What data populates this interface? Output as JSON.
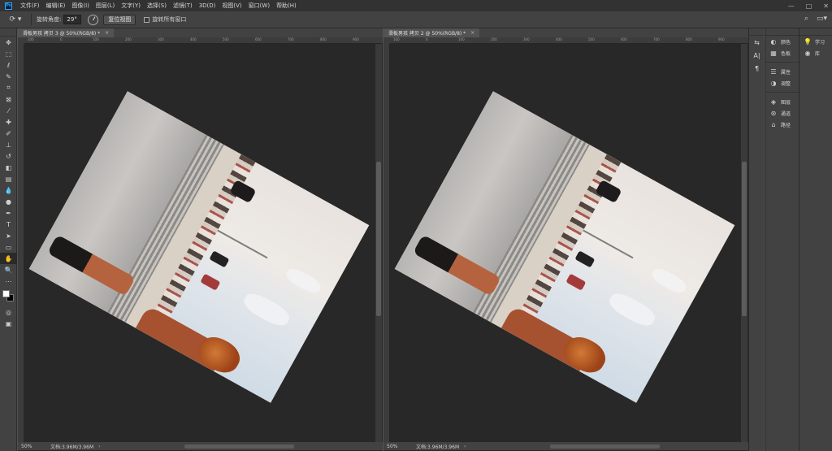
{
  "app": {
    "logo": "Ps"
  },
  "menu": [
    "文件(F)",
    "编辑(E)",
    "图像(I)",
    "图层(L)",
    "文字(Y)",
    "选择(S)",
    "滤镜(T)",
    "3D(D)",
    "视图(V)",
    "窗口(W)",
    "帮助(H)"
  ],
  "window_controls": {
    "minimize": "—",
    "maximize": "□",
    "close": "✕"
  },
  "options": {
    "tool_icon": "rotate-view-icon",
    "rotation_label": "旋转角度:",
    "rotation_value": "29°",
    "reset_view_label": "复位视图",
    "rotate_all_label": "旋转所有窗口",
    "search_icon": "search-icon",
    "workspace_icon": "workspace-icon"
  },
  "tools": [
    {
      "name": "move-tool",
      "glyph": "✥"
    },
    {
      "name": "marquee-tool",
      "glyph": "⬚"
    },
    {
      "name": "lasso-tool",
      "glyph": "ℓ"
    },
    {
      "name": "quick-select-tool",
      "glyph": "✎"
    },
    {
      "name": "crop-tool",
      "glyph": "⌗"
    },
    {
      "name": "frame-tool",
      "glyph": "⊠"
    },
    {
      "name": "eyedropper-tool",
      "glyph": "⁄"
    },
    {
      "name": "healing-brush-tool",
      "glyph": "✚"
    },
    {
      "name": "brush-tool",
      "glyph": "✐"
    },
    {
      "name": "clone-stamp-tool",
      "glyph": "⊥"
    },
    {
      "name": "history-brush-tool",
      "glyph": "↺"
    },
    {
      "name": "eraser-tool",
      "glyph": "◧"
    },
    {
      "name": "gradient-tool",
      "glyph": "▤"
    },
    {
      "name": "blur-tool",
      "glyph": "💧"
    },
    {
      "name": "dodge-tool",
      "glyph": "●"
    },
    {
      "name": "pen-tool",
      "glyph": "✒"
    },
    {
      "name": "type-tool",
      "glyph": "T"
    },
    {
      "name": "path-selection-tool",
      "glyph": "➤"
    },
    {
      "name": "rectangle-tool",
      "glyph": "▭"
    },
    {
      "name": "hand-tool",
      "glyph": "✋"
    },
    {
      "name": "zoom-tool",
      "glyph": "🔍"
    },
    {
      "name": "more-tools",
      "glyph": "⋯"
    }
  ],
  "tools_bottom": [
    {
      "name": "quick-mask-tool",
      "glyph": "◎"
    },
    {
      "name": "screen-mode-tool",
      "glyph": "▣"
    }
  ],
  "colors": {
    "foreground": "#ffffff",
    "background": "#000000",
    "accent": "#31a8ff"
  },
  "documents": [
    {
      "tab": "滑板男孩 拷贝 3 @ 50%(RGB/8) *",
      "close": "×",
      "zoom": "50%",
      "doc_info": "文档:3.96M/3.96M",
      "status_arrow": "›"
    },
    {
      "tab": "滑板男孩 拷贝 2 @ 50%(RGB/8) *",
      "close": "×",
      "zoom": "50%",
      "doc_info": "文档:3.96M/3.96M",
      "status_arrow": "›"
    }
  ],
  "ruler_ticks": [
    "100",
    "0",
    "100",
    "200",
    "300",
    "400",
    "500",
    "600",
    "700",
    "800",
    "900"
  ],
  "dock_icons": [
    {
      "name": "history-icon",
      "glyph": "⇆"
    },
    {
      "name": "character-icon",
      "glyph": "A|"
    },
    {
      "name": "paragraph-icon",
      "glyph": "¶"
    }
  ],
  "panels": [
    {
      "name": "color-panel",
      "icon": "◐",
      "label": "颜色"
    },
    {
      "name": "swatches-panel",
      "icon": "▦",
      "label": "色板"
    },
    {
      "name": "properties-panel",
      "icon": "☰",
      "label": "属性"
    },
    {
      "name": "adjustments-panel",
      "icon": "◑",
      "label": "调整"
    },
    {
      "name": "layers-panel",
      "icon": "◈",
      "label": "图层"
    },
    {
      "name": "channels-panel",
      "icon": "⊛",
      "label": "通道"
    },
    {
      "name": "paths-panel",
      "icon": "⌂",
      "label": "路径"
    }
  ],
  "panels_right": [
    {
      "name": "learn-panel",
      "icon": "💡",
      "label": "学习"
    },
    {
      "name": "libraries-panel",
      "icon": "◉",
      "label": "库"
    }
  ]
}
